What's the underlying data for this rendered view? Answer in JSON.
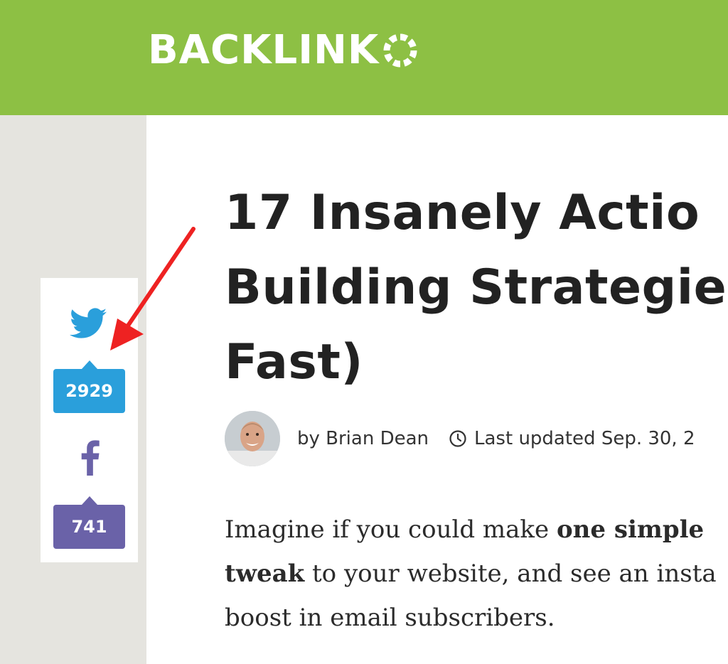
{
  "header": {
    "logo_text": "BACKLINK",
    "bg_color": "#8dc044"
  },
  "article": {
    "title_lines": [
      "17 Insanely Actio",
      "Building Strategie",
      "Fast)"
    ],
    "author_text": "by Brian Dean",
    "updated_text": "Last updated Sep. 30, 2",
    "intro": {
      "l1_pre": "Imagine if you could make ",
      "l1_bold": "one simple",
      "l2_bold": "tweak",
      "l2_post": " to your website, and see an insta",
      "l3": "boost in email subscribers."
    }
  },
  "share": {
    "twitter": {
      "icon": "twitter-bird-icon",
      "count": "2929",
      "color": "#2a9fdb"
    },
    "facebook": {
      "icon": "facebook-icon",
      "count": "741",
      "color": "#6a62a8"
    }
  },
  "annotation": {
    "color": "#ee2222"
  }
}
